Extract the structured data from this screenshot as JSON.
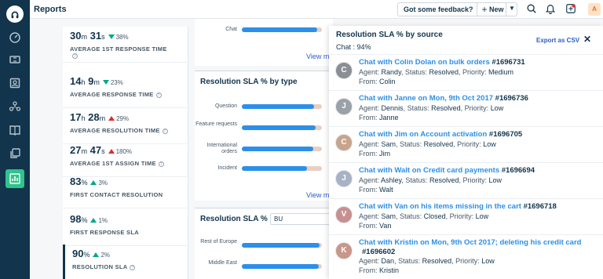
{
  "app": {
    "title": "Reports",
    "feedback_label": "Got some feedback?",
    "new_label": "New",
    "avatar_letter": "A"
  },
  "colors": {
    "nav_bg": "#12344d",
    "active_nav": "#2fc48c",
    "bar_fill": "#2c8fe9",
    "bar_track": "#e9cfc2",
    "link": "#2c5cc5"
  },
  "nav_icons": [
    "logo-icon",
    "dashboard-icon",
    "tickets-icon",
    "contacts-icon",
    "groups-icon",
    "knowledge-base-icon",
    "copy-icon",
    "reports-icon"
  ],
  "metrics": [
    {
      "value_main": "30",
      "unit1": "m",
      "value_sec": "31",
      "unit2": "s",
      "change": "38%",
      "dir": "down",
      "label": "AVERAGE 1ST RESPONSE TIME",
      "info_below": true
    },
    {
      "value_main": "14",
      "unit1": "h",
      "value_sec": "9",
      "unit2": "m",
      "change": "23%",
      "dir": "down",
      "label": "AVERAGE RESPONSE TIME",
      "info_below": false
    },
    {
      "value_main": "17",
      "unit1": "h",
      "value_sec": "28",
      "unit2": "m",
      "change": "29%",
      "dir": "up-red",
      "label": "AVERAGE RESOLUTION TIME",
      "info_below": false
    },
    {
      "value_main": "27",
      "unit1": "m",
      "value_sec": "47",
      "unit2": "s",
      "change": "180%",
      "dir": "up-red",
      "label": "AVERAGE 1ST ASSIGN TIME",
      "info_below": false
    },
    {
      "value_main": "83",
      "unit1": "%",
      "value_sec": "",
      "unit2": "",
      "change": "3%",
      "dir": "up",
      "label": "FIRST CONTACT RESOLUTION",
      "info_below": false
    },
    {
      "value_main": "98",
      "unit1": "%",
      "value_sec": "",
      "unit2": "",
      "change": "1%",
      "dir": "up",
      "label": "FIRST RESPONSE SLA",
      "info_below": true
    },
    {
      "value_main": "90",
      "unit1": "%",
      "value_sec": "",
      "unit2": "",
      "change": "2%",
      "dir": "up",
      "label": "RESOLUTION SLA",
      "info_below": false
    }
  ],
  "cards": {
    "source_top": {
      "rows": [
        {
          "label": "Chat",
          "pct": 0.94
        }
      ],
      "view_more": "View m"
    },
    "by_type": {
      "title": "Resolution SLA % by type",
      "rows": [
        {
          "label": "Question",
          "pct": 0.9
        },
        {
          "label": "Feature requests",
          "pct": 0.92
        },
        {
          "label": "International orders",
          "pct": 0.89
        },
        {
          "label": "Incident",
          "pct": 0.81
        }
      ],
      "view_more": "View m"
    },
    "by_bu": {
      "title": "Resolution SLA % by",
      "select_value": "BU",
      "rows": [
        {
          "label": "Rest of Europe",
          "pct": 0.97
        },
        {
          "label": "Middle East",
          "pct": 0.96
        }
      ]
    }
  },
  "panel": {
    "title": "Resolution SLA % by source",
    "subtitle": "Chat : 94%",
    "export_label": "Export as CSV",
    "close_label": "✕",
    "agent_prefix": "Agent:",
    "status_prefix": "Status:",
    "priority_prefix": "Priority:",
    "from_prefix": "From:",
    "tickets": [
      {
        "subject": "Chat with Colin Dolan on bulk orders",
        "number": "#1696731",
        "agent": "Randy",
        "status": "Resolved",
        "priority": "Medium",
        "from": "Colin",
        "initial": "C",
        "avatar_color": "#8a8f96"
      },
      {
        "subject": "Chat with Janne on Mon, 9th Oct 2017",
        "number": "#1696736",
        "agent": "Dennis",
        "status": "Resolved",
        "priority": "Low",
        "from": "Janne",
        "initial": "J",
        "avatar_color": "#9aa1a8"
      },
      {
        "subject": "Chat with Jim on Account activation",
        "number": "#1696705",
        "agent": "Sam",
        "status": "Resolved",
        "priority": "Low",
        "from": "Jim",
        "initial": "C",
        "avatar_color": "#c9a48c"
      },
      {
        "subject": "Chat with Walt on Credit card payments",
        "number": "#1696694",
        "agent": "Ashley",
        "status": "Resolved",
        "priority": "Low",
        "from": "Walt",
        "initial": "J",
        "avatar_color": "#a7b2c4"
      },
      {
        "subject": "Chat with Van on his items missing in the cart",
        "number": "#1696718",
        "agent": "Sam",
        "status": "Closed",
        "priority": "Low",
        "from": "Van",
        "initial": "V",
        "avatar_color": "#c79090"
      },
      {
        "subject": "Chat with Kristin on Mon, 9th Oct 2017; deleting his credit card",
        "number": "#1696602",
        "agent": "Dan",
        "status": "Resolved",
        "priority": "Low",
        "from": "Kristin",
        "initial": "K",
        "avatar_color": "#c8978a"
      }
    ]
  }
}
